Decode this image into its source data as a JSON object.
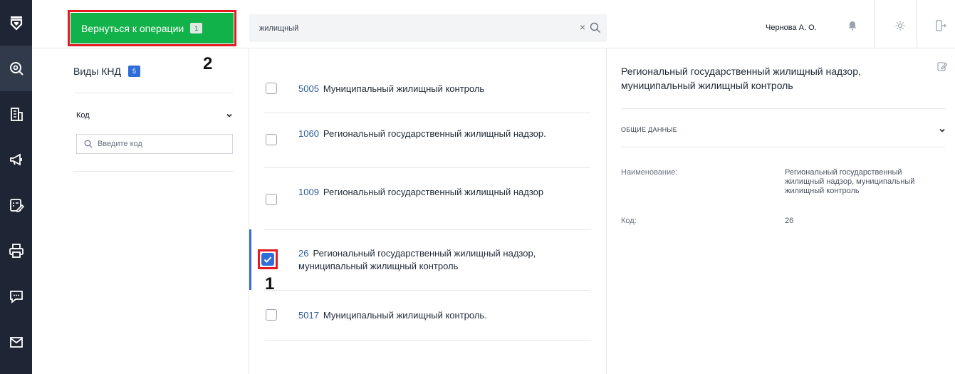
{
  "toolbar": {
    "back_label": "Вернуться к операции",
    "back_badge": "1",
    "search_value": "жилищный",
    "clear_glyph": "×",
    "user_name": "Чернова А. О.",
    "annotation_marker_2": "2"
  },
  "rail": {
    "icons": [
      "logo-shield-icon",
      "search-icon",
      "building-icon",
      "megaphone-icon",
      "edit-doc-icon",
      "printer-icon",
      "chat-icon",
      "mail-icon"
    ]
  },
  "filter": {
    "title": "Виды КНД",
    "count": "5",
    "code_label": "Код",
    "code_placeholder": "Введите код"
  },
  "results": [
    {
      "code": "5005",
      "name": "Муниципальный жилищный контроль",
      "checked": false
    },
    {
      "code": "1060",
      "name": "Региональный государственный жилищный надзор.",
      "checked": false
    },
    {
      "code": "1009",
      "name": "Региональный государственный жилищный надзор",
      "checked": false
    },
    {
      "code": "26",
      "name": "Региональный государственный жилищный надзор, муниципальный жилищный контроль",
      "checked": true
    },
    {
      "code": "5017",
      "name": "Муниципальный жилищный контроль.",
      "checked": false
    }
  ],
  "annotation_marker_1": "1",
  "details": {
    "title": "Региональный государственный жилищный надзор, муниципальный жилищный контроль",
    "section": "ОБЩИЕ ДАННЫЕ",
    "name_label": "Наименование:",
    "name_value": "Региональный государственный жилищный надзор, муниципальный жилищный контроль",
    "code_label": "Код:",
    "code_value": "26"
  },
  "colors": {
    "rail_bg": "#1e2534",
    "accent_green": "#12b24a",
    "accent_blue": "#2f6ed8",
    "annotation_red": "#e31b23"
  }
}
